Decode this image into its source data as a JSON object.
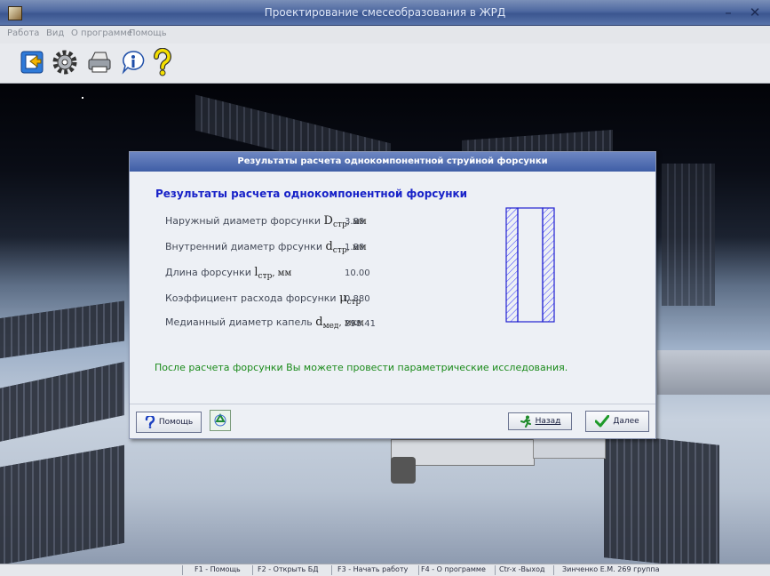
{
  "window": {
    "title": "Проектирование смесеобразования в ЖРД",
    "minimize": "–",
    "close": "✕"
  },
  "menu": [
    "Работа",
    "Вид",
    "О программе",
    "Помощь"
  ],
  "toolbar": [
    "open-icon",
    "gear-icon",
    "printer-icon",
    "info-icon",
    "help-icon"
  ],
  "dialog": {
    "header": "Результаты расчета однокомпонентной струйной форсунки",
    "heading": "Результаты расчета однокомпонентной форсунки",
    "rows": [
      {
        "label": "Наружный диаметр форсунки",
        "sym": "D",
        "sub": "стр",
        "unit": ", мм",
        "value": "3.80"
      },
      {
        "label": "Внутренний диаметр фрсунки",
        "sym": "d",
        "sub": "стр",
        "unit": ", мм",
        "value": "1.80"
      },
      {
        "label": "Длина форсунки",
        "sym": "l",
        "sub": "стр",
        "unit": ", мм",
        "value": "10.00"
      },
      {
        "label": "Коэффициент расхода форсунки",
        "sym": "μ",
        "sub": "стр",
        "unit": "",
        "value": "0.880"
      },
      {
        "label": "Медианный диаметр капель",
        "sym": "d",
        "sub": "мед",
        "unit": ", мкм",
        "value": "298.41"
      }
    ],
    "note": "После расчета форсунки Вы можете провести параметрические исследования.",
    "buttons": {
      "help": "Помощь",
      "back": "Назад",
      "next": "Далее"
    }
  },
  "status": [
    "F1 - Помощь",
    "F2 - Открыть БД",
    "F3 - Начать работу",
    "F4 - О программе",
    "Ctr-x -Выход",
    "Зинченко Е.М. 269 группа"
  ],
  "colors": {
    "heading": "#1822c8",
    "note": "#1a8a1a",
    "titlebar": "#4e68a0"
  }
}
